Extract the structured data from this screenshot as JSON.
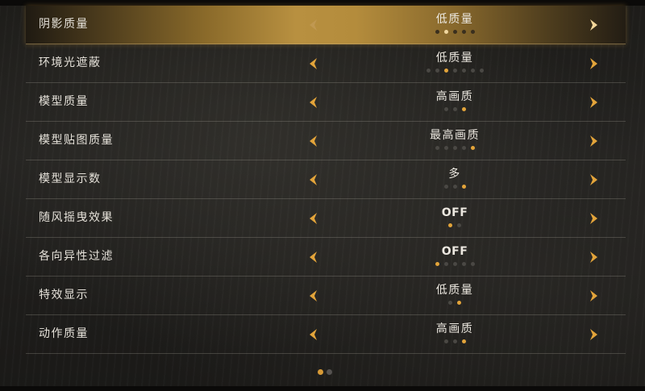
{
  "colors": {
    "accent": "#e3a43a",
    "text": "#e6e2da"
  },
  "settings": [
    {
      "label": "阴影质量",
      "value": "低质量",
      "dots": 5,
      "active": 2,
      "selected": true
    },
    {
      "label": "环境光遮蔽",
      "value": "低质量",
      "dots": 7,
      "active": 3,
      "selected": false
    },
    {
      "label": "模型质量",
      "value": "高画质",
      "dots": 3,
      "active": 3,
      "selected": false
    },
    {
      "label": "模型贴图质量",
      "value": "最高画质",
      "dots": 5,
      "active": 5,
      "selected": false
    },
    {
      "label": "模型显示数",
      "value": "多",
      "dots": 3,
      "active": 3,
      "selected": false
    },
    {
      "label": "随风摇曳效果",
      "value": "OFF",
      "dots": 2,
      "active": 1,
      "selected": false
    },
    {
      "label": "各向异性过滤",
      "value": "OFF",
      "dots": 5,
      "active": 1,
      "selected": false
    },
    {
      "label": "特效显示",
      "value": "低质量",
      "dots": 2,
      "active": 2,
      "selected": false
    },
    {
      "label": "动作质量",
      "value": "高画质",
      "dots": 3,
      "active": 3,
      "selected": false
    }
  ],
  "pager": {
    "pages": 2,
    "current": 1
  },
  "icons": {
    "prev": "chevron-left-icon",
    "next": "chevron-right-icon"
  }
}
